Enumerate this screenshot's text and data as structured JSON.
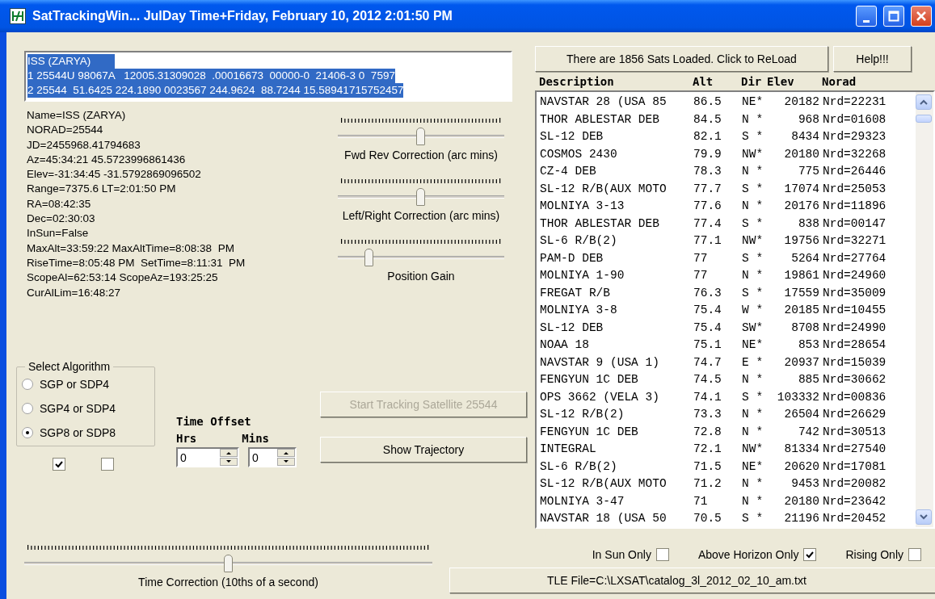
{
  "window": {
    "title": "SatTrackingWin... JulDay Time+Friday, February 10, 2012 2:01:50 PM"
  },
  "tle_box": {
    "lines": [
      "ISS (ZARYA)        ",
      "1 25544U 98067A   12005.31309028  .00016673  00000-0  21406-3 0  7597",
      "2 25544  51.6425 224.1890 0023567 244.9624  88.7244 15.58941715752457"
    ]
  },
  "info_lines": [
    "Name=ISS (ZARYA)",
    "NORAD=25544",
    "JD=2455968.41794683",
    "Az=45:34:21 45.5723996861436",
    "Elev=-31:34:45 -31.5792869096502",
    "Range=7375.6 LT=2:01:50 PM",
    "RA=08:42:35",
    "Dec=02:30:03",
    "InSun=False",
    "MaxAlt=33:59:22 MaxAltTime=8:08:38  PM",
    "RiseTime=8:05:48 PM  SetTime=8:11:31  PM",
    "ScopeAl=62:53:14 ScopeAz=193:25:25",
    "CurAlLim=16:48:27"
  ],
  "sliders": [
    {
      "label": "Fwd Rev Correction (arc mins)",
      "level": 0.5
    },
    {
      "label": "Left/Right Correction (arc mins)",
      "level": 0.5
    },
    {
      "label": "Position Gain",
      "level": 0.19
    }
  ],
  "algorithm_group": {
    "title": "Select Algorithm",
    "options": [
      {
        "label": "SGP or SDP4",
        "selected": false
      },
      {
        "label": "SGP4 or SDP4",
        "selected": false
      },
      {
        "label": "SGP8 or SDP8",
        "selected": true
      }
    ]
  },
  "checkboxes": [
    {
      "checked": true
    },
    {
      "checked": false
    }
  ],
  "time_offset": {
    "title": "Time Offset",
    "hours": {
      "label": "Hrs",
      "value": "0"
    },
    "minutes": {
      "label": "Mins",
      "value": "0"
    }
  },
  "buttons": [
    {
      "label": "Start Tracking Satellite 25544",
      "disabled": true
    },
    {
      "label": "Show Trajectory",
      "disabled": false
    }
  ],
  "time_correction": {
    "label": "Time Correction (10ths of a second)",
    "level": 0.5
  },
  "reload_button": "There are 1856 Sats Loaded. Click to ReLoad",
  "help_button": "Help!!!",
  "table": {
    "columns": [
      "Description",
      "Alt",
      "Dir",
      "Elev",
      "Norad"
    ],
    "rows": [
      [
        "NAVSTAR 28 (USA 85",
        "86.5",
        "NE*",
        "20182",
        "Nrd=22231"
      ],
      [
        "THOR ABLESTAR DEB",
        "84.5",
        "N *",
        "968",
        "Nrd=01608"
      ],
      [
        "SL-12 DEB",
        "82.1",
        "S *",
        "8434",
        "Nrd=29323"
      ],
      [
        "COSMOS 2430",
        "79.9",
        "NW*",
        "20180",
        "Nrd=32268"
      ],
      [
        "CZ-4 DEB",
        "78.3",
        "N *",
        "775",
        "Nrd=26446"
      ],
      [
        "SL-12 R/B(AUX MOTO",
        "77.7",
        "S *",
        "17074",
        "Nrd=25053"
      ],
      [
        "MOLNIYA 3-13",
        "77.6",
        "N *",
        "20176",
        "Nrd=11896"
      ],
      [
        "THOR ABLESTAR DEB",
        "77.4",
        "S *",
        "838",
        "Nrd=00147"
      ],
      [
        "SL-6 R/B(2)",
        "77.1",
        "NW*",
        "19756",
        "Nrd=32271"
      ],
      [
        "PAM-D DEB",
        "77",
        "S *",
        "5264",
        "Nrd=27764"
      ],
      [
        "MOLNIYA 1-90",
        "77",
        "N *",
        "19861",
        "Nrd=24960"
      ],
      [
        "FREGAT R/B",
        "76.3",
        "S *",
        "17559",
        "Nrd=35009"
      ],
      [
        "MOLNIYA 3-8",
        "75.4",
        "W *",
        "20185",
        "Nrd=10455"
      ],
      [
        "SL-12 DEB",
        "75.4",
        "SW*",
        "8708",
        "Nrd=24990"
      ],
      [
        "NOAA 18",
        "75.1",
        "NE*",
        "853",
        "Nrd=28654"
      ],
      [
        "NAVSTAR 9 (USA 1)",
        "74.7",
        "E *",
        "20937",
        "Nrd=15039"
      ],
      [
        "FENGYUN 1C DEB",
        "74.5",
        "N *",
        "885",
        "Nrd=30662"
      ],
      [
        "OPS 3662 (VELA 3)",
        "74.1",
        "S *",
        "103332",
        "Nrd=00836"
      ],
      [
        "SL-12 R/B(2)",
        "73.3",
        "N *",
        "26504",
        "Nrd=26629"
      ],
      [
        "FENGYUN 1C DEB",
        "72.8",
        "N *",
        "742",
        "Nrd=30513"
      ],
      [
        "INTEGRAL",
        "72.1",
        "NW*",
        "81334",
        "Nrd=27540"
      ],
      [
        "SL-6 R/B(2)",
        "71.5",
        "NE*",
        "20620",
        "Nrd=17081"
      ],
      [
        "SL-12 R/B(AUX MOTO",
        "71.2",
        "N *",
        "9453",
        "Nrd=20082"
      ],
      [
        "MOLNIYA 3-47",
        "71",
        "N *",
        "20180",
        "Nrd=23642"
      ],
      [
        "NAVSTAR 18 (USA 50",
        "70.5",
        "S *",
        "21196",
        "Nrd=20452"
      ]
    ]
  },
  "filters": [
    {
      "label": "In Sun Only",
      "checked": false
    },
    {
      "label": "Above Horizon Only",
      "checked": true
    },
    {
      "label": "Rising Only",
      "checked": false
    }
  ],
  "tle_file_button": "TLE File=C:\\LXSAT\\catalog_3l_2012_02_10_am.txt"
}
